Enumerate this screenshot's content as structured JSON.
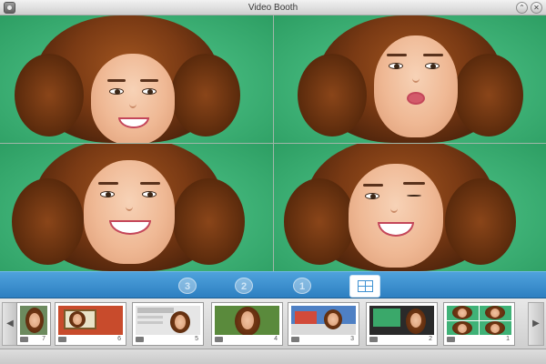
{
  "window": {
    "title": "Video Booth"
  },
  "toolbar": {
    "countdown": [
      "3",
      "2",
      "1"
    ],
    "layout_mode": "grid-2x2"
  },
  "filmstrip": {
    "thumbnails": [
      {
        "number": "7"
      },
      {
        "number": "6"
      },
      {
        "number": "5"
      },
      {
        "number": "4"
      },
      {
        "number": "3"
      },
      {
        "number": "2"
      },
      {
        "number": "1"
      }
    ]
  },
  "colors": {
    "toolbar_blue": "#3a8fd0",
    "green_screen": "#3fb277",
    "hair_brown": "#7a3a14"
  }
}
